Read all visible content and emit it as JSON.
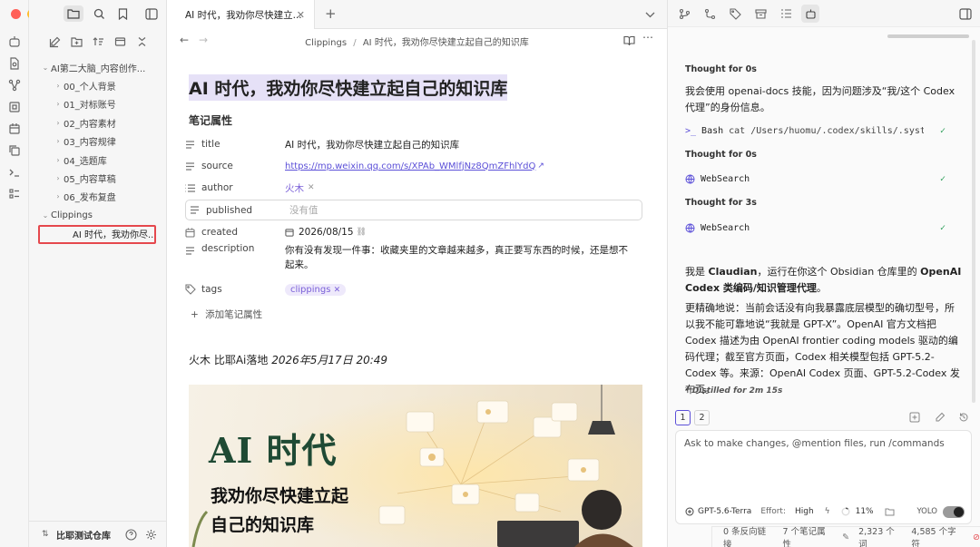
{
  "window": {
    "controls": [
      {
        "name": "close",
        "color": "#ff5f57"
      },
      {
        "name": "minimize",
        "color": "#febc2e"
      },
      {
        "name": "maximize",
        "color": "#28c840"
      }
    ]
  },
  "sidebar": {
    "vault_name": "比耶测试仓库",
    "tree": [
      {
        "label": "AI第二大脑_内容创作...",
        "level": 0,
        "caret": "⌄"
      },
      {
        "label": "00_个人背景",
        "level": 1,
        "caret": "›"
      },
      {
        "label": "01_对标账号",
        "level": 1,
        "caret": "›"
      },
      {
        "label": "02_内容素材",
        "level": 1,
        "caret": "›"
      },
      {
        "label": "03_内容规律",
        "level": 1,
        "caret": "›"
      },
      {
        "label": "04_选题库",
        "level": 1,
        "caret": "›"
      },
      {
        "label": "05_内容草稿",
        "level": 1,
        "caret": "›"
      },
      {
        "label": "06_发布复盘",
        "level": 1,
        "caret": "›"
      },
      {
        "label": "Clippings",
        "level": 0,
        "caret": "⌄"
      },
      {
        "label": "AI 时代，我劝你尽...",
        "level": 2,
        "caret": "",
        "selected": true
      }
    ],
    "highlight_color": "#e5484d"
  },
  "tab": {
    "title": "AI 时代，我劝你尽快建立...",
    "new_tab": "+"
  },
  "editor": {
    "breadcrumb": {
      "folder": "Clippings",
      "sep": "/",
      "file": "AI 时代，我劝你尽快建立起自己的知识库"
    },
    "title": "AI 时代，我劝你尽快建立起自己的知识库",
    "props_heading": "笔记属性",
    "props": {
      "title": {
        "key": "title",
        "value": "AI 时代，我劝你尽快建立起自己的知识库"
      },
      "source": {
        "key": "source",
        "value": "https://mp.weixin.qq.com/s/XPAb_WMlfjNz8QmZFhlYdQ"
      },
      "author": {
        "key": "author",
        "value": "火木"
      },
      "published": {
        "key": "published",
        "value": "没有值"
      },
      "created": {
        "key": "created",
        "value": "2026/08/15"
      },
      "description": {
        "key": "description",
        "line1": "你有没有发现一件事：收藏夹里的文章越来越多，真正要写东西的时候，还是想不",
        "line2": "起来。"
      },
      "tags": {
        "key": "tags",
        "value": "clippings"
      }
    },
    "add_prop": "添加笔记属性",
    "byline": {
      "prefix": "火木 比耶Ai落地 ",
      "date": "2026年5月17日 20:49"
    },
    "cover": {
      "line1": "AI 时代",
      "line2": "我劝你尽快建立起",
      "line3": "自己的知识库"
    },
    "link_color": "#5b4fd8",
    "tag_color": "#7b61d8"
  },
  "chat": {
    "blocks": {
      "t1": "Thought for 0s",
      "p1": "我会使用 openai-docs 技能，因为问题涉及“我/这个 Codex 代理”的身份信息。",
      "bash": {
        "label": "Bash",
        "cmd": "cat /Users/huomu/.codex/skills/.system/..."
      },
      "t2": "Thought for 0s",
      "ws1": "WebSearch",
      "t3": "Thought for 3s",
      "ws2": "WebSearch",
      "answer1": {
        "pre": "我是 ",
        "b1": "Claudian",
        "mid": "，运行在你这个 Obsidian 仓库里的 ",
        "b2": "OpenAI Codex 类编码/知识管理代理",
        "end": "。"
      },
      "answer2": "更精确地说：当前会话没有向我暴露底层模型的确切型号，所以我不能可靠地说“我就是 GPT-X”。OpenAI 官方文档把 Codex 描述为由 OpenAI frontier coding models 驱动的编码代理；截至官方页面，Codex 相关模型包括 GPT-5.2-Codex 等。来源：OpenAI Codex 页面、GPT-5.2-Codex 发布页。",
      "distilled": "* Distilled for 2m 15s"
    },
    "pages": [
      "1",
      "2"
    ],
    "input_placeholder": "Ask to make changes, @mention files, run /commands",
    "model": "GPT-5.6-Terra",
    "effort_label": "Effort:",
    "effort_value": "High",
    "context_pct": "11%",
    "yolo": "YOLO"
  },
  "status": {
    "backlinks": "0 条反向链接",
    "props": "7 个笔记属性",
    "words": "2,323 个词",
    "chars": "4,585 个字符"
  }
}
